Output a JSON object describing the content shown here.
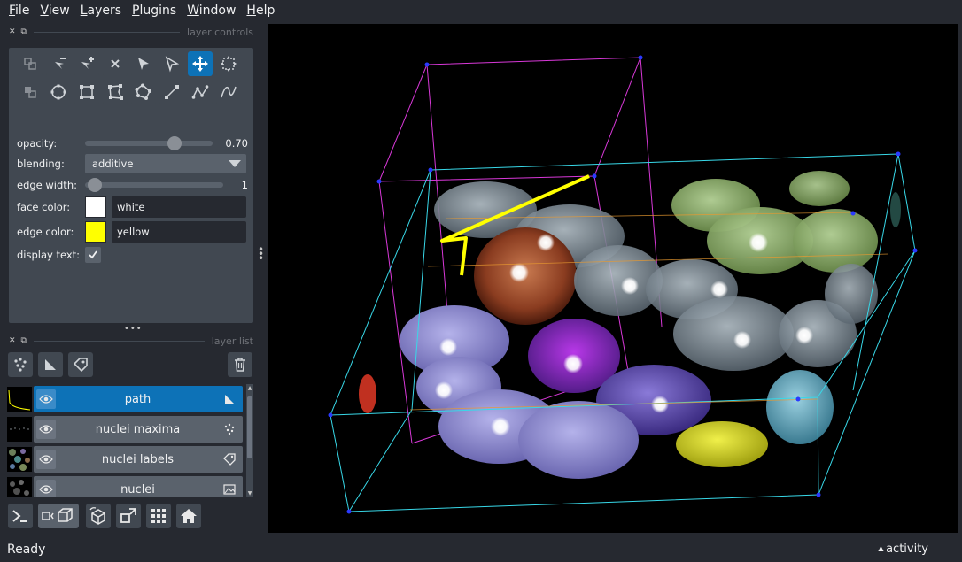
{
  "menu": [
    {
      "label": "File",
      "mnemonic": "F",
      "rest": "ile"
    },
    {
      "label": "View",
      "mnemonic": "V",
      "rest": "iew"
    },
    {
      "label": "Layers",
      "mnemonic": "L",
      "rest": "ayers"
    },
    {
      "label": "Plugins",
      "mnemonic": "P",
      "rest": "lugins"
    },
    {
      "label": "Window",
      "mnemonic": "W",
      "rest": "indow"
    },
    {
      "label": "Help",
      "mnemonic": "H",
      "rest": "elp"
    }
  ],
  "layer_controls": {
    "title": "layer controls",
    "tools_row1": [
      "shape-select-icon",
      "delete-vertex-icon",
      "add-vertex-icon",
      "delete-shape-icon",
      "select-shape-icon",
      "direct-select-icon",
      "pan-zoom-icon",
      "transform-icon"
    ],
    "tools_row2": [
      "move-back-icon",
      "ellipse-icon",
      "rectangle-icon",
      "polygon-icon",
      "polygon-lasso-icon",
      "line-icon",
      "path-icon",
      "polyline-icon"
    ],
    "active_tool": "pan-zoom-icon",
    "opacity": {
      "label": "opacity:",
      "value": "0.70",
      "fraction": 0.7
    },
    "blending": {
      "label": "blending:",
      "value": "additive"
    },
    "edge_width": {
      "label": "edge width:",
      "value": "1",
      "fraction": 0.02
    },
    "face_color": {
      "label": "face color:",
      "value": "white",
      "swatch": "#ffffff"
    },
    "edge_color": {
      "label": "edge color:",
      "value": "yellow",
      "swatch": "#ffff00"
    },
    "display_text": {
      "label": "display text:",
      "checked": true
    }
  },
  "layer_list": {
    "title": "layer list",
    "layers": [
      {
        "name": "path",
        "type_icon": "shapes-icon",
        "selected": true
      },
      {
        "name": "nuclei maxima",
        "type_icon": "points-icon",
        "selected": false
      },
      {
        "name": "nuclei labels",
        "type_icon": "labels-icon",
        "selected": false
      },
      {
        "name": "nuclei",
        "type_icon": "image-icon",
        "selected": false
      }
    ]
  },
  "status": {
    "text": "Ready",
    "activity": "activity"
  },
  "colors": {
    "accent": "#0d72b7",
    "panel": "#414851",
    "background": "#262930",
    "control": "#5a626c"
  }
}
